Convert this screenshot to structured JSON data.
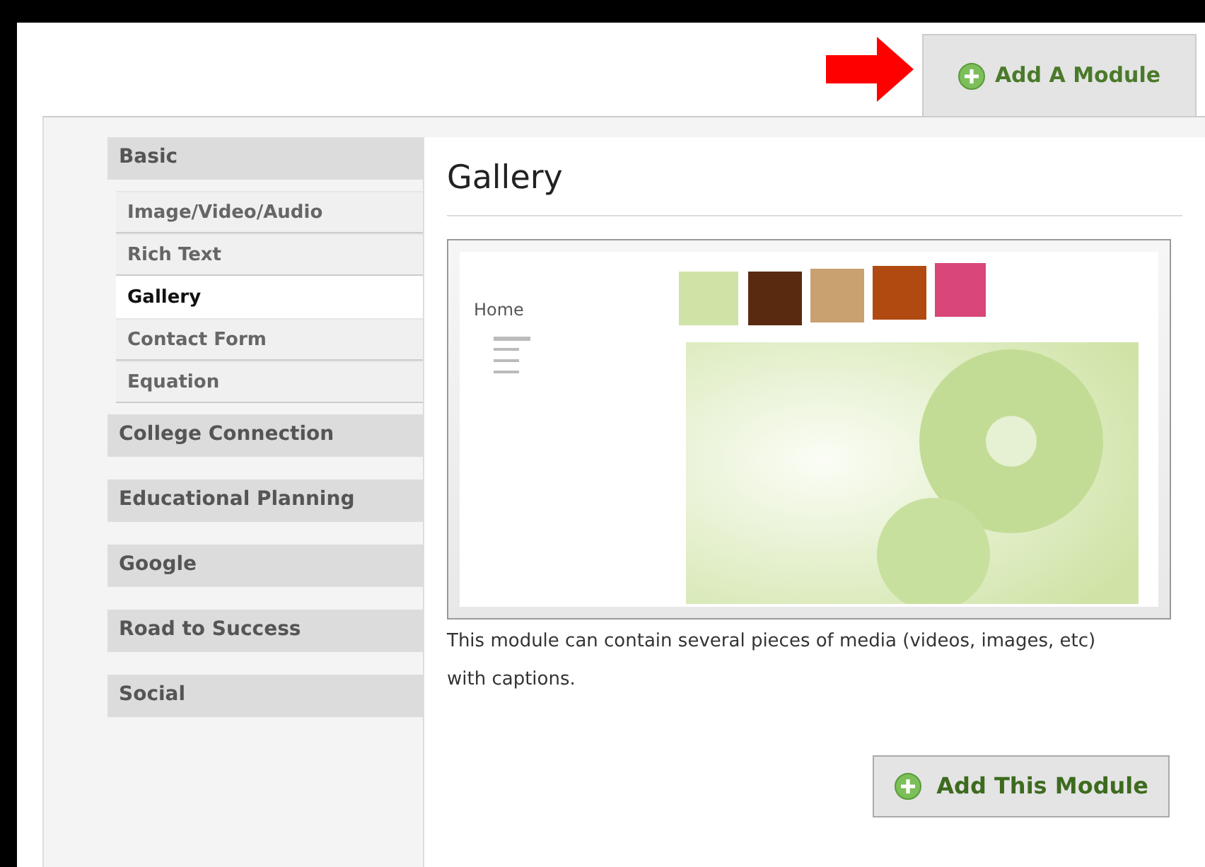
{
  "tab": {
    "label": "Add A Module",
    "selected": true
  },
  "categories": [
    {
      "label": "Basic",
      "children": [
        {
          "label": "Image/Video/Audio",
          "selected": false
        },
        {
          "label": "Rich Text",
          "selected": false
        },
        {
          "label": "Gallery",
          "selected": true
        },
        {
          "label": "Contact Form",
          "selected": false
        },
        {
          "label": "Equation",
          "selected": false
        }
      ]
    },
    {
      "label": "College Connection"
    },
    {
      "label": "Educational Planning"
    },
    {
      "label": "Google"
    },
    {
      "label": "Road to Success"
    },
    {
      "label": "Social"
    }
  ],
  "detail": {
    "title": "Gallery",
    "preview": {
      "heading": "Home"
    },
    "description": "This module can contain several pieces of media (videos, images, etc) with captions.",
    "button": "Add This Module"
  }
}
